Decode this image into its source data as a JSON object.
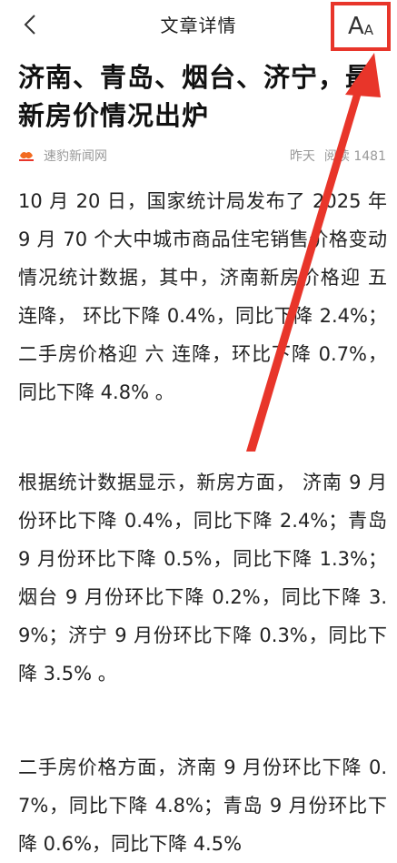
{
  "nav": {
    "title": "文章详情",
    "back_icon": "chevron-left-icon",
    "font_size_icon": "font-size-icon"
  },
  "article": {
    "title": "济南、青岛、烟台、济宁，最新房价情况出炉",
    "source": "速豹新闻网",
    "time": "昨天",
    "reads": "阅读 1481",
    "paragraphs": [
      "10 月 20 日，国家统计局发布了 2025 年 9 月 70 个大中城市商品住宅销售价格变动情况统计数据，其中，济南新房价格迎 五 连降， 环比下降 0.4%，同比下降 2.4%；二手房价格迎 六 连降，环比下降 0.7%，同比下降 4.8% 。",
      "根据统计数据显示，新房方面， 济南 9 月份环比下降 0.4%，同比下降 2.4%；青岛 9 月份环比下降 0.5%，同比下降 1.3%；烟台 9 月份环比下降 0.2%，同比下降 3.9%；济宁 9 月份环比下降 0.3%，同比下降 3.5% 。",
      "二手房价格方面，济南 9 月份环比下降 0.7%，同比下降 4.8%；青岛 9 月份环比下降 0.6%，同比下降 4.5%"
    ]
  },
  "colors": {
    "highlight": "#e8352a",
    "meta": "#999999",
    "text": "#222222"
  }
}
